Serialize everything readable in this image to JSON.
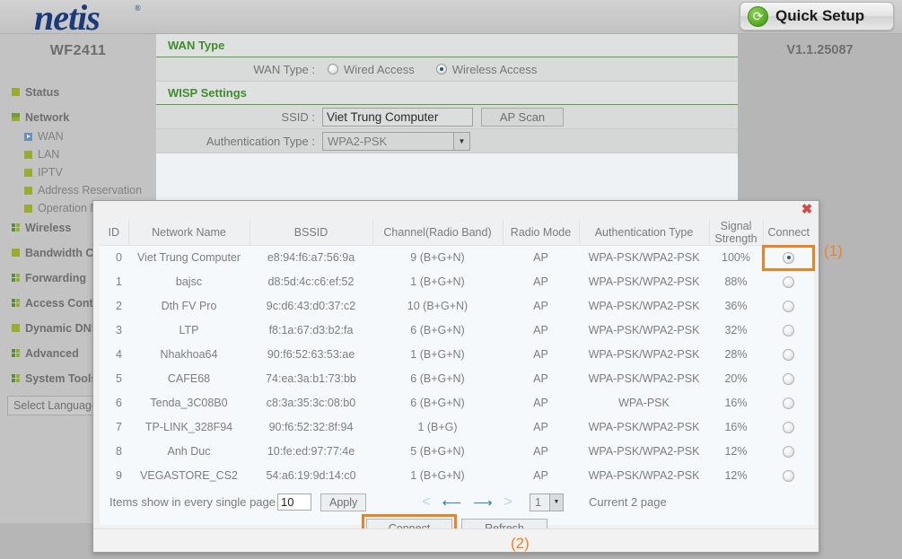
{
  "header": {
    "logo": "netis",
    "logo_mark": "®",
    "quick_setup_label": "Quick Setup",
    "quick_setup_icon": "refresh-circle-icon"
  },
  "sidebar": {
    "model": "WF2411",
    "items": [
      {
        "label": "Status",
        "type": "top",
        "bullet": "single"
      },
      {
        "label": "Network",
        "type": "top",
        "bullet": "bar"
      },
      {
        "label": "WAN",
        "type": "sub",
        "bullet": "tri"
      },
      {
        "label": "LAN",
        "type": "sub",
        "bullet": "single"
      },
      {
        "label": "IPTV",
        "type": "sub",
        "bullet": "single"
      },
      {
        "label": "Address Reservation",
        "type": "sub",
        "bullet": "single"
      },
      {
        "label": "Operation Mode",
        "type": "sub",
        "bullet": "single"
      },
      {
        "label": "Wireless",
        "type": "top",
        "bullet": "quad"
      },
      {
        "label": "Bandwidth Control",
        "type": "top",
        "bullet": "single"
      },
      {
        "label": "Forwarding",
        "type": "top",
        "bullet": "quad"
      },
      {
        "label": "Access Control",
        "type": "top",
        "bullet": "quad"
      },
      {
        "label": "Dynamic DNS",
        "type": "top",
        "bullet": "single"
      },
      {
        "label": "Advanced",
        "type": "top",
        "bullet": "quad"
      },
      {
        "label": "System Tools",
        "type": "top",
        "bullet": "quad"
      }
    ],
    "language_select": "Select Language"
  },
  "version": "V1.1.25087",
  "main": {
    "wan_type_section": "WAN Type",
    "wan_type_label": "WAN Type :",
    "wan_type_options": [
      {
        "label": "Wired Access",
        "selected": false
      },
      {
        "label": "Wireless Access",
        "selected": true
      }
    ],
    "wisp_section": "WISP Settings",
    "ssid_label": "SSID :",
    "ssid_value": "Viet Trung Computer",
    "ap_scan_label": "AP Scan",
    "auth_label": "Authentication Type :",
    "auth_value": "WPA2-PSK"
  },
  "modal": {
    "close_icon": "close-icon",
    "columns": [
      "ID",
      "Network Name",
      "BSSID",
      "Channel(Radio Band)",
      "Radio Mode",
      "Authentication Type",
      "Signal Strength",
      "Connect"
    ],
    "rows": [
      {
        "id": "0",
        "name": "Viet Trung Computer",
        "bssid": "e8:94:f6:a7:56:9a",
        "channel": "9 (B+G+N)",
        "mode": "AP",
        "auth": "WPA-PSK/WPA2-PSK",
        "signal": "100%",
        "selected": true
      },
      {
        "id": "1",
        "name": "bajsc",
        "bssid": "d8:5d:4c:c6:ef:52",
        "channel": "1 (B+G+N)",
        "mode": "AP",
        "auth": "WPA-PSK/WPA2-PSK",
        "signal": "88%",
        "selected": false
      },
      {
        "id": "2",
        "name": "Dth FV Pro",
        "bssid": "9c:d6:43:d0:37:c2",
        "channel": "10 (B+G+N)",
        "mode": "AP",
        "auth": "WPA-PSK/WPA2-PSK",
        "signal": "36%",
        "selected": false
      },
      {
        "id": "3",
        "name": "LTP",
        "bssid": "f8:1a:67:d3:b2:fa",
        "channel": "6 (B+G+N)",
        "mode": "AP",
        "auth": "WPA-PSK/WPA2-PSK",
        "signal": "32%",
        "selected": false
      },
      {
        "id": "4",
        "name": "Nhakhoa64",
        "bssid": "90:f6:52:63:53:ae",
        "channel": "1 (B+G+N)",
        "mode": "AP",
        "auth": "WPA-PSK/WPA2-PSK",
        "signal": "28%",
        "selected": false
      },
      {
        "id": "5",
        "name": "CAFE68",
        "bssid": "74:ea:3a:b1:73:bb",
        "channel": "6 (B+G+N)",
        "mode": "AP",
        "auth": "WPA-PSK/WPA2-PSK",
        "signal": "20%",
        "selected": false
      },
      {
        "id": "6",
        "name": "Tenda_3C08B0",
        "bssid": "c8:3a:35:3c:08:b0",
        "channel": "6 (B+G+N)",
        "mode": "AP",
        "auth": "WPA-PSK",
        "signal": "16%",
        "selected": false
      },
      {
        "id": "7",
        "name": "TP-LINK_328F94",
        "bssid": "90:f6:52:32:8f:94",
        "channel": "1 (B+G)",
        "mode": "AP",
        "auth": "WPA-PSK/WPA2-PSK",
        "signal": "16%",
        "selected": false
      },
      {
        "id": "8",
        "name": "Anh Duc",
        "bssid": "10:fe:ed:97:77:4e",
        "channel": "5 (B+G+N)",
        "mode": "AP",
        "auth": "WPA-PSK/WPA2-PSK",
        "signal": "12%",
        "selected": false
      },
      {
        "id": "9",
        "name": "VEGASTORE_CS2",
        "bssid": "54:a6:19:9d:14:c0",
        "channel": "1 (B+G+N)",
        "mode": "AP",
        "auth": "WPA-PSK/WPA2-PSK",
        "signal": "12%",
        "selected": false
      }
    ],
    "pager": {
      "items_label": "Items show in every single page",
      "items_value": "10",
      "apply_label": "Apply",
      "first_icon": "chevron-first-icon",
      "prev_icon": "arrow-left-icon",
      "next_icon": "arrow-right-icon",
      "last_icon": "chevron-last-icon",
      "page_value": "1",
      "current_page_label": "Current 2 page"
    },
    "connect_label": "Connect",
    "refresh_label": "Refresh"
  },
  "annotations": {
    "one": "(1)",
    "two": "(2)"
  }
}
